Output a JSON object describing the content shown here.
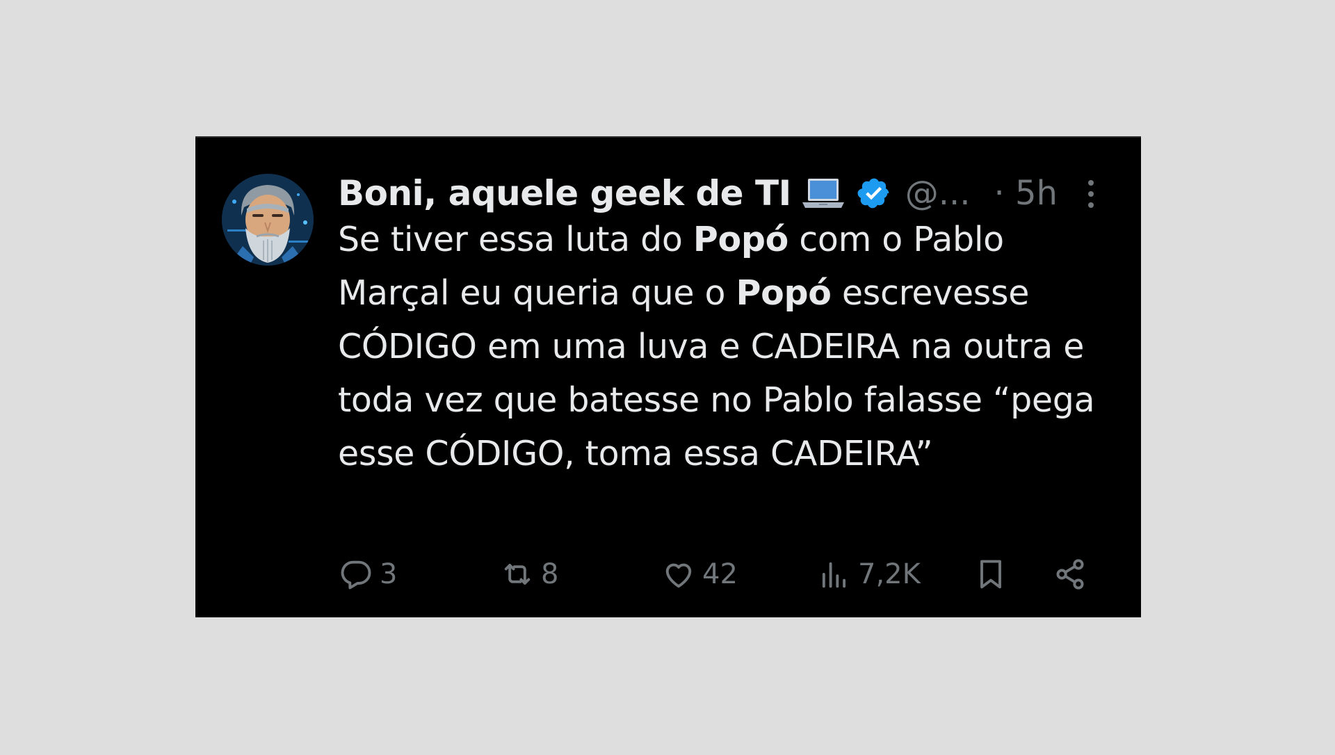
{
  "tweet": {
    "author_name": "Boni, aquele geek de TI",
    "handle": "@...",
    "time": "· 5h",
    "body_parts": [
      {
        "text": "Se tiver essa luta do ",
        "bold": false
      },
      {
        "text": "Popó",
        "bold": true
      },
      {
        "text": " com o Pablo Marçal eu queria que o ",
        "bold": false
      },
      {
        "text": "Popó",
        "bold": true
      },
      {
        "text": " escrevesse CÓDIGO em uma luva e CADEIRA na outra e toda vez que batesse no Pablo falasse “pega esse CÓDIGO, toma essa CADEIRA”",
        "bold": false
      }
    ]
  },
  "actions": {
    "replies": "3",
    "retweets": "8",
    "likes": "42",
    "views": "7,2K"
  },
  "icons": {
    "name_emoji": "laptop-icon",
    "badge": "verified-badge-icon",
    "more": "more-vertical-icon",
    "reply": "reply-icon",
    "retweet": "retweet-icon",
    "like": "heart-icon",
    "views": "views-chart-icon",
    "bookmark": "bookmark-icon",
    "share": "share-icon"
  },
  "colors": {
    "background": "#000000",
    "text": "#e7e9ea",
    "muted": "#71767b",
    "verified": "#1d9bf0",
    "page": "#dedede"
  }
}
